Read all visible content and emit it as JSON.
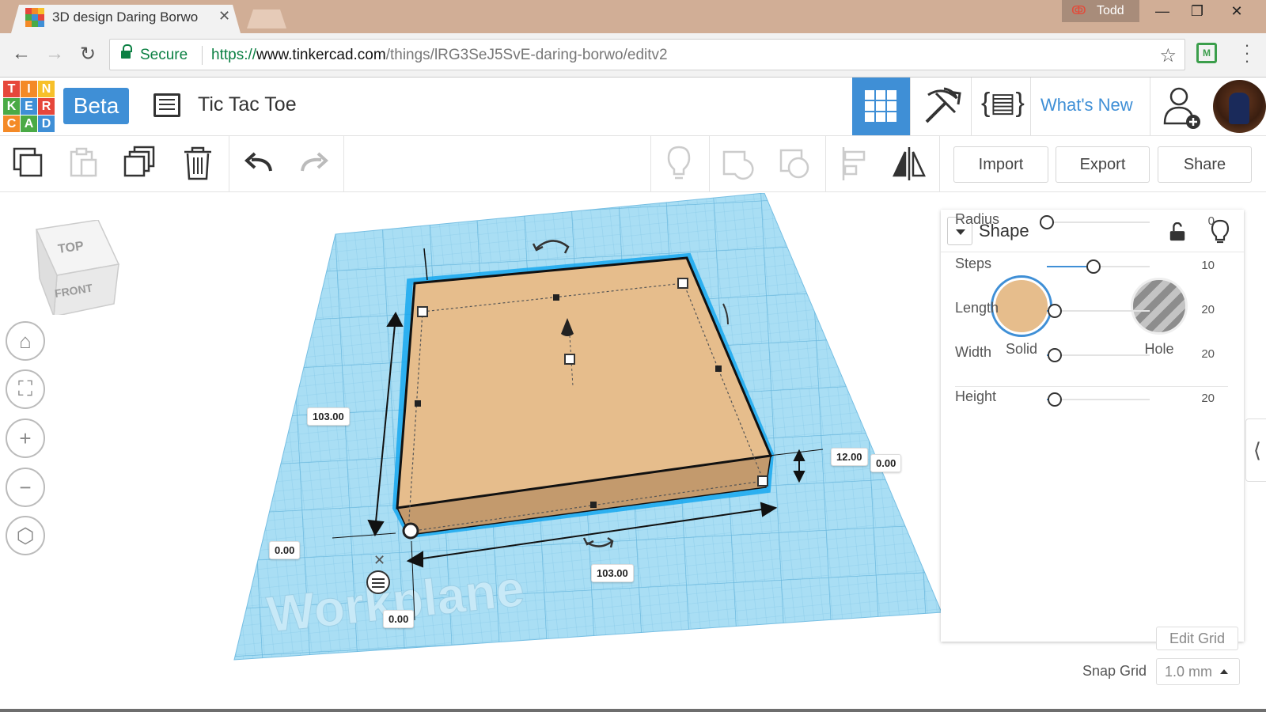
{
  "browser": {
    "tab_title": "3D design Daring Borwo",
    "tab_close": "✕",
    "profile_name": "Todd",
    "url_scheme": "https://",
    "url_host": "www.tinkercad.com",
    "url_path": "/things/lRG3SeJ5SvE-daring-borwo/editv2",
    "secure_label": "Secure",
    "window_buttons": {
      "minimize": "—",
      "restore": "❐",
      "close": "✕"
    },
    "ext_label": "M"
  },
  "logo_letters": [
    "T",
    "I",
    "N",
    "K",
    "E",
    "R",
    "C",
    "A",
    "D"
  ],
  "logo_colors": [
    "#e6473b",
    "#f48a27",
    "#f7c02a",
    "#4aaa46",
    "#3f8fd6",
    "#e6473b",
    "#f48a27",
    "#4aaa46",
    "#3f8fd6"
  ],
  "favicon_colors": [
    "#e6473b",
    "#f48a27",
    "#f7c02a",
    "#4aaa46",
    "#3f8fd6",
    "#e6473b",
    "#f48a27",
    "#4aaa46",
    "#3f8fd6"
  ],
  "header": {
    "beta_label": "Beta",
    "design_title": "Tic Tac Toe",
    "whats_new": "What's New",
    "accent_color": "#3f8fd6"
  },
  "toolbar": {
    "import_label": "Import",
    "export_label": "Export",
    "share_label": "Share",
    "icons": [
      "copy-icon",
      "paste-icon",
      "duplicate-icon",
      "delete-icon",
      "undo-icon",
      "redo-icon",
      "lightbulb-icon",
      "group-icon",
      "ungroup-icon",
      "align-icon",
      "mirror-icon"
    ]
  },
  "viewcube": {
    "top": "TOP",
    "front": "FRONT"
  },
  "view_controls": [
    "home-icon",
    "fit-view-icon",
    "zoom-in-icon",
    "zoom-out-icon",
    "ortho-view-icon"
  ],
  "workplane": {
    "label": "Workplane",
    "dims": {
      "height": "103.00",
      "width": "103.00",
      "elevation": "12.00",
      "offset_right": "0.00",
      "offset_left": "0.00",
      "offset_bottom": "0.00"
    },
    "shape_color": "#e6bd8c",
    "grid_color": "#8fd0ee"
  },
  "inspector": {
    "title": "Shape",
    "solid_label": "Solid",
    "hole_label": "Hole",
    "props": [
      {
        "label": "Radius",
        "value": "0",
        "fraction": 0.0
      },
      {
        "label": "Steps",
        "value": "10",
        "fraction": 0.45
      },
      {
        "label": "Length",
        "value": "20",
        "fraction": 0.08
      },
      {
        "label": "Width",
        "value": "20",
        "fraction": 0.08
      },
      {
        "label": "Height",
        "value": "20",
        "fraction": 0.08
      }
    ]
  },
  "grid_settings": {
    "edit_grid": "Edit Grid",
    "snap_label": "Snap Grid",
    "snap_value": "1.0 mm"
  }
}
